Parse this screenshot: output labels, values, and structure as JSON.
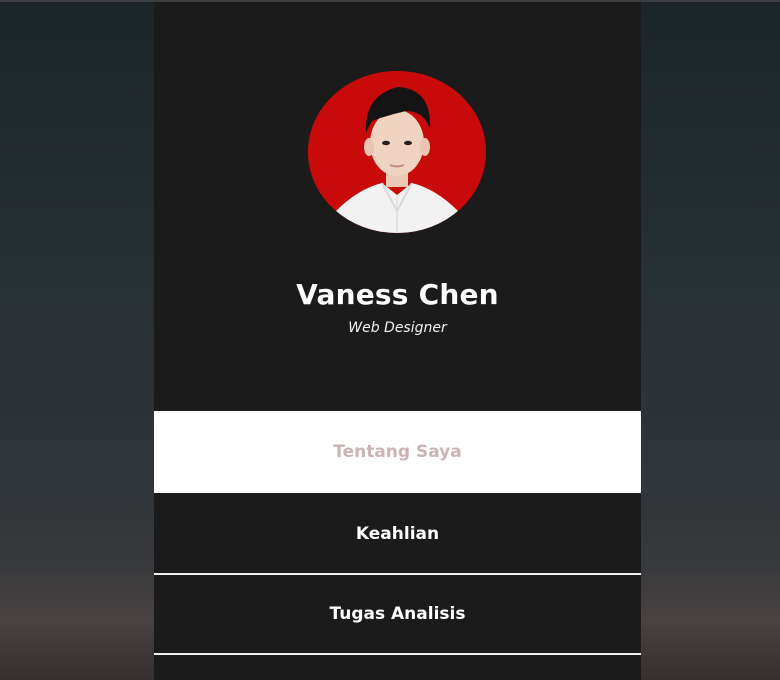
{
  "profile": {
    "name": "Vaness Chen",
    "role": "Web Designer",
    "photo_bg_color": "#c80a0a"
  },
  "menu": {
    "items": [
      {
        "label": "Tentang Saya",
        "active": true
      },
      {
        "label": "Keahlian",
        "active": false
      },
      {
        "label": "Tugas Analisis",
        "active": false
      }
    ]
  },
  "colors": {
    "card_bg": "#1b1b1b",
    "active_item_bg": "#ffffff",
    "active_item_text": "#cdb3b3",
    "item_text": "#ffffff"
  }
}
